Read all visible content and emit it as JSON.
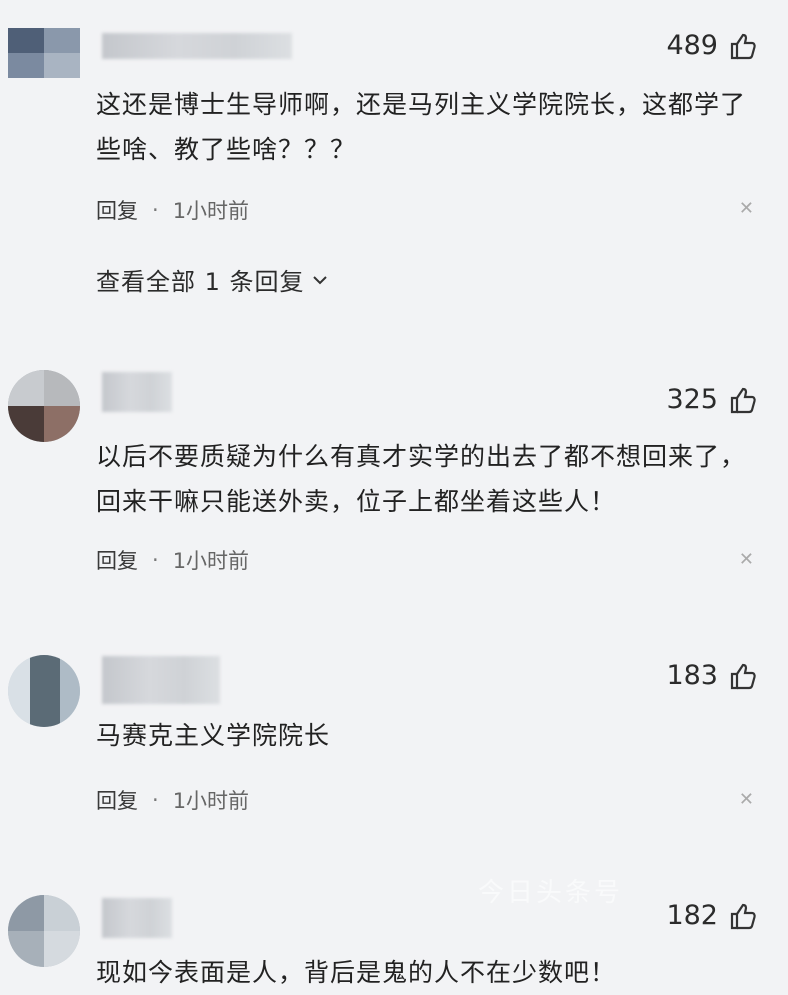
{
  "comments": [
    {
      "likes": "489",
      "text": "这还是博士生导师啊，还是马列主义学院院长，这都学了些啥、教了些啥？？？",
      "reply_label": "回复",
      "time": "1小时前",
      "view_all": "查看全部 1 条回复"
    },
    {
      "likes": "325",
      "text": "以后不要质疑为什么有真才实学的出去了都不想回来了，回来干嘛只能送外卖，位子上都坐着这些人！",
      "reply_label": "回复",
      "time": "1小时前"
    },
    {
      "likes": "183",
      "text": "马赛克主义学院院长",
      "reply_label": "回复",
      "time": "1小时前"
    },
    {
      "likes": "182",
      "text": "现如今表面是人，背后是鬼的人不在少数吧！"
    }
  ],
  "separator": "·",
  "watermark": "今日头条号",
  "icons": {
    "like": "thumbs-up-icon",
    "expand": "chevron-down-icon",
    "close": "close-icon"
  }
}
